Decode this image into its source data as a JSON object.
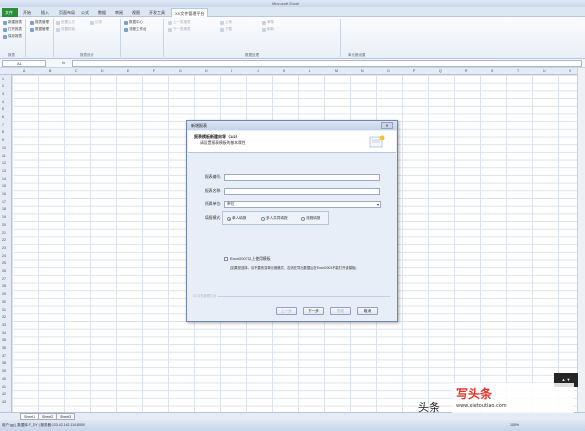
{
  "window": {
    "title": "Microsoft Excel"
  },
  "tabs": [
    {
      "label": "文件",
      "active": false
    },
    {
      "label": "开始",
      "active": false
    },
    {
      "label": "插入",
      "active": false
    },
    {
      "label": "页面布局",
      "active": false
    },
    {
      "label": "公式",
      "active": false
    },
    {
      "label": "数据",
      "active": false
    },
    {
      "label": "审阅",
      "active": false
    },
    {
      "label": "视图",
      "active": false
    },
    {
      "label": "开发工具",
      "active": false
    },
    {
      "label": "XX文件管理平台",
      "active": true
    }
  ],
  "ribbon": {
    "groups": [
      "报表",
      "报表设计",
      "数据处理",
      "单元格设置"
    ],
    "items": {
      "new_report": "新建报表",
      "open_report": "打开报表",
      "save_report": "保存报表",
      "report_manage": "报表管理",
      "data_manage": "数据管理",
      "record": "记录",
      "data_center": "数据中心",
      "flow": "流程工作台",
      "set_formula": "设置公式",
      "set_check": "设置校验",
      "prev": "上一张报表",
      "next": "下一张报表",
      "upload": "上传",
      "download": "下载",
      "check": "审核",
      "refresh": "刷新"
    }
  },
  "formula_bar": {
    "name_box": "A1",
    "fx": "fx"
  },
  "grid": {
    "columns": [
      "A",
      "B",
      "C",
      "D",
      "E",
      "F",
      "G",
      "H",
      "I",
      "J",
      "K",
      "L",
      "M",
      "N",
      "O",
      "P",
      "Q",
      "R",
      "S",
      "T",
      "U",
      "V"
    ],
    "rows": [
      "1",
      "2",
      "3",
      "4",
      "5",
      "6",
      "7",
      "8",
      "9",
      "10",
      "11",
      "12",
      "13",
      "14",
      "15",
      "16",
      "17",
      "18",
      "19",
      "20",
      "21",
      "22",
      "23",
      "24",
      "25",
      "26",
      "27",
      "28",
      "29",
      "30",
      "31",
      "32",
      "33",
      "34",
      "35",
      "36",
      "37",
      "38",
      "39",
      "40",
      "41",
      "42",
      "43"
    ]
  },
  "sheets": [
    "Sheet1",
    "Sheet2",
    "Sheet3"
  ],
  "status": {
    "text": "用户:gyj | 数据库:F_DY | 服务器:123.42.142.114:8090",
    "zoom": "100%"
  },
  "dialog": {
    "title": "新增报表",
    "header_title": "报表模板新建向导（1/2）",
    "header_sub": "请设置报表模板的基本属性",
    "fields": {
      "code_label": "报表编号:",
      "name_label": "报表名称:",
      "unit_label": "所属单位:",
      "unit_value": "单位",
      "mode_label": "填报模式:"
    },
    "radios": [
      {
        "label": "单人填报",
        "selected": true
      },
      {
        "label": "多人共同填报",
        "selected": false
      },
      {
        "label": "流程填报",
        "selected": false
      }
    ],
    "checkbox_label": "Excel2007以上使用模板",
    "note": "(如果是选择，请不要改变单元格格式，否则在导出数据后在Excel2003不能打开该模板)",
    "footer_hint": "XX文件管理平台",
    "buttons": {
      "prev": "上一步",
      "next": "下一步",
      "finish": "完成",
      "cancel": "取消"
    }
  },
  "watermark": {
    "brand": "头条",
    "site": "www.xietoutiao.com",
    "prefix": "写头条",
    "outside": "头条"
  }
}
